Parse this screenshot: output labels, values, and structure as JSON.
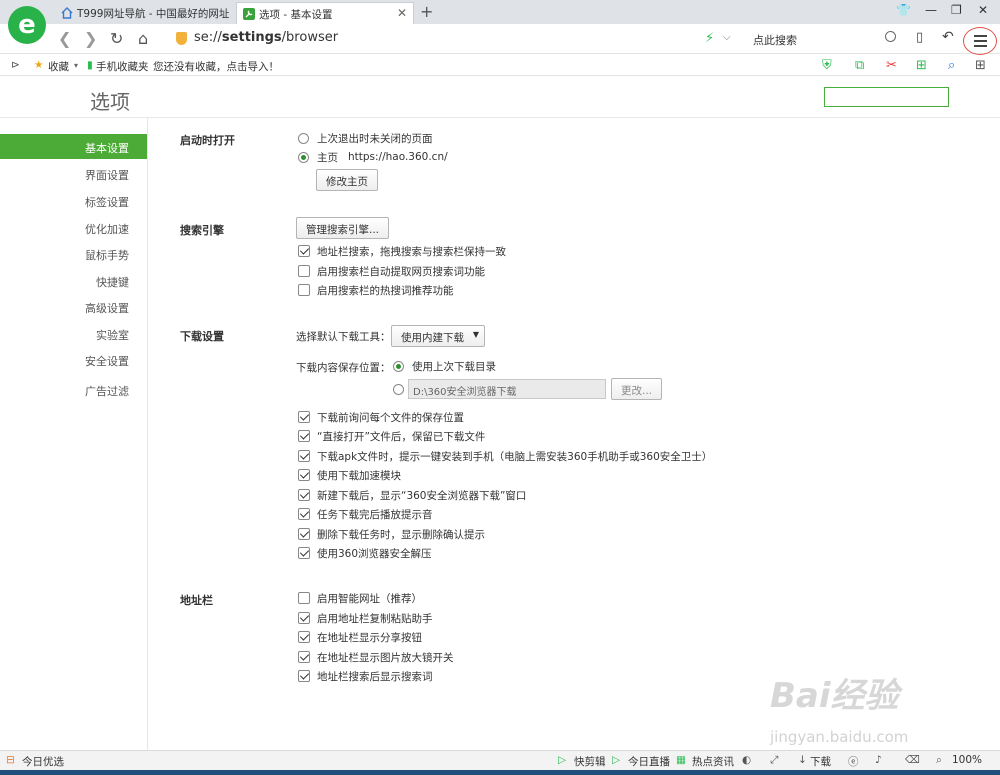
{
  "tabs": [
    {
      "title": "T999网址导航 - 中国最好的网址",
      "active": false
    },
    {
      "title": "选项 - 基本设置",
      "active": true
    }
  ],
  "address": {
    "prefix": "se://",
    "bold": "settings",
    "suffix": "/browser"
  },
  "search_placeholder": "点此搜索",
  "favbar": {
    "favorites": "收藏",
    "mobile": "手机收藏夹",
    "hint": "您还没有收藏，点击导入！"
  },
  "page": {
    "title": "选项",
    "sidebar": [
      "基本设置",
      "界面设置",
      "标签设置",
      "优化加速",
      "鼠标手势",
      "快捷键",
      "高级设置",
      "实验室",
      "安全设置",
      "广告过滤"
    ],
    "startup": {
      "label": "启动时打开",
      "option_last": "上次退出时未关闭的页面",
      "option_home": "主页",
      "home_url": "https://hao.360.cn/",
      "change_home": "修改主页"
    },
    "search_engine": {
      "label": "搜索引擎",
      "manage": "管理搜索引擎...",
      "options": [
        {
          "text": "地址栏搜索，拖拽搜索与搜索栏保持一致",
          "checked": true
        },
        {
          "text": "启用搜索栏自动提取网页搜索词功能",
          "checked": false
        },
        {
          "text": "启用搜索栏的热搜词推荐功能",
          "checked": false
        }
      ]
    },
    "download": {
      "label": "下载设置",
      "tool_label": "选择默认下载工具：",
      "tool_value": "使用内建下载",
      "save_label": "下载内容保存位置：",
      "save_last": "使用上次下载目录",
      "path": "D:\\360安全浏览器下载",
      "change": "更改...",
      "options": [
        {
          "text": "下载前询问每个文件的保存位置",
          "checked": true
        },
        {
          "text": "“直接打开”文件后，保留已下载文件",
          "checked": true
        },
        {
          "text": "下载apk文件时，提示一键安装到手机（电脑上需安装360手机助手或360安全卫士）",
          "checked": true
        },
        {
          "text": "使用下载加速模块",
          "checked": true
        },
        {
          "text": "新建下载后，显示“360安全浏览器下载”窗口",
          "checked": true
        },
        {
          "text": "任务下载完后播放提示音",
          "checked": true
        },
        {
          "text": "删除下载任务时，显示删除确认提示",
          "checked": true
        },
        {
          "text": "使用360浏览器安全解压",
          "checked": true
        }
      ]
    },
    "addressbar": {
      "label": "地址栏",
      "options": [
        {
          "text": "启用智能网址（推荐）",
          "checked": false
        },
        {
          "text": "启用地址栏复制粘贴助手",
          "checked": true
        },
        {
          "text": "在地址栏显示分享按钮",
          "checked": true
        },
        {
          "text": "在地址栏显示图片放大镜开关",
          "checked": true
        },
        {
          "text": "地址栏搜索后显示搜索词",
          "checked": true
        }
      ]
    }
  },
  "statusbar": {
    "left": "今日优选",
    "clip": "快剪辑",
    "live": "今日直播",
    "news": "热点资讯",
    "download": "下载",
    "zoom": "100%"
  },
  "watermark": {
    "main": "Bai经验",
    "sub": "jingyan.baidu.com"
  },
  "colors": {
    "accent": "#4cab37",
    "tabbar": "#dfe3e8"
  }
}
